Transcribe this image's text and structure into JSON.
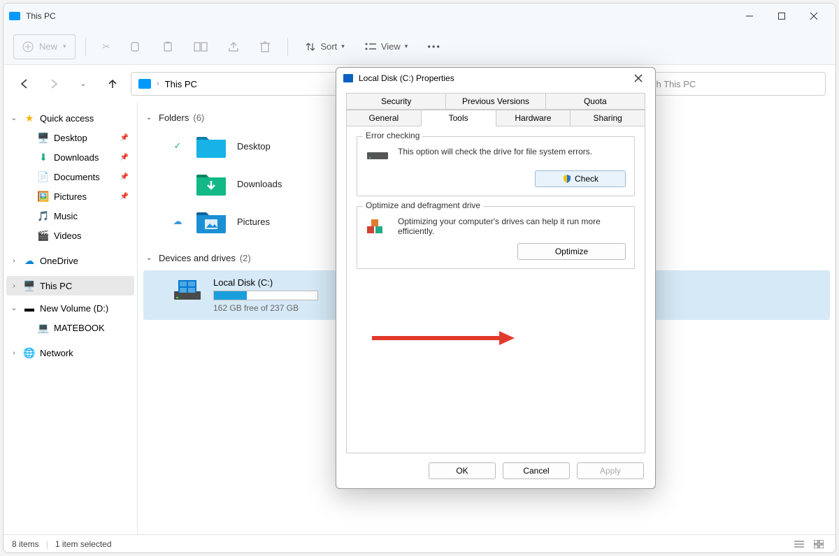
{
  "window": {
    "title": "This PC"
  },
  "toolbar": {
    "new_label": "New",
    "sort_label": "Sort",
    "view_label": "View"
  },
  "address": {
    "path": "This PC",
    "search_placeholder": "Search This PC",
    "search_visible_text": "ch This PC"
  },
  "sidebar": {
    "quick_access": "Quick access",
    "items": [
      {
        "label": "Desktop"
      },
      {
        "label": "Downloads"
      },
      {
        "label": "Documents"
      },
      {
        "label": "Pictures"
      },
      {
        "label": "Music"
      },
      {
        "label": "Videos"
      }
    ],
    "onedrive": "OneDrive",
    "this_pc": "This PC",
    "new_volume": "New Volume (D:)",
    "matebook": "MATEBOOK",
    "network": "Network"
  },
  "content": {
    "folders_group": "Folders",
    "folders_count": "(6)",
    "folders": [
      {
        "label": "Desktop"
      },
      {
        "label": "Downloads"
      },
      {
        "label": "Pictures"
      }
    ],
    "devices_group": "Devices and drives",
    "devices_count": "(2)",
    "drive": {
      "name": "Local Disk (C:)",
      "free_text": "162 GB free of 237 GB",
      "used_pct": 32
    }
  },
  "status": {
    "items": "8 items",
    "selected": "1 item selected"
  },
  "dialog": {
    "title": "Local Disk (C:) Properties",
    "tabs_row1": [
      "Security",
      "Previous Versions",
      "Quota"
    ],
    "tabs_row2": [
      "General",
      "Tools",
      "Hardware",
      "Sharing"
    ],
    "active_tab": "Tools",
    "error_checking": {
      "legend": "Error checking",
      "text": "This option will check the drive for file system errors.",
      "button": "Check"
    },
    "optimize": {
      "legend": "Optimize and defragment drive",
      "text": "Optimizing your computer's drives can help it run more efficiently.",
      "button": "Optimize"
    },
    "buttons": {
      "ok": "OK",
      "cancel": "Cancel",
      "apply": "Apply"
    }
  }
}
